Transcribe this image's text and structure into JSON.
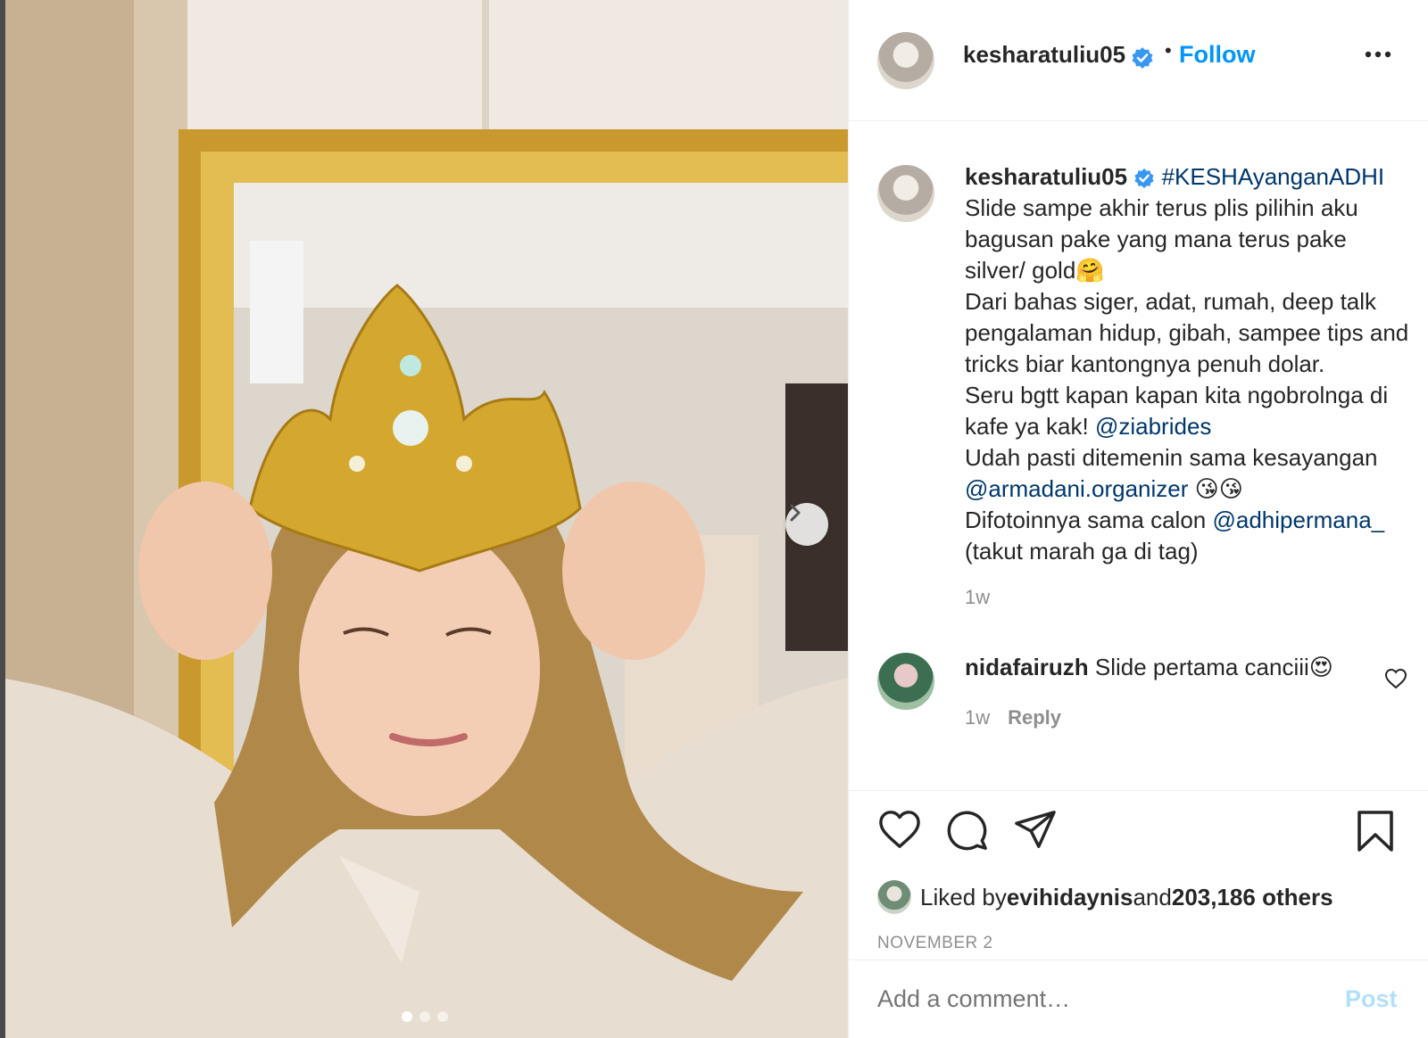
{
  "post": {
    "username": "kesharatuliu05",
    "follow_label": "Follow",
    "separator": "•",
    "caption": {
      "username": "kesharatuliu05",
      "hashtag": "#KESHAyanganADHI",
      "line1": "Slide sampe akhir terus plis pilihin aku bagusan pake yang mana terus pake silver/ gold🤗",
      "line2": "Dari bahas siger, adat, rumah, deep talk pengalaman hidup, gibah, sampee tips and tricks biar kantongnya penuh dolar.",
      "line3_pre": "Seru bgtt kapan kapan kita ngobrolnga di kafe ya kak! ",
      "mention1": "@ziabrides",
      "line4_pre": "Udah pasti ditemenin sama kesayangan ",
      "mention2": "@armadani.organizer",
      "line4_post": " 😘😘",
      "line5_pre": "Difotoinnya sama calon ",
      "mention3": "@adhipermana_",
      "line6": "(takut marah ga di tag)",
      "time": "1w"
    },
    "comment": {
      "username": "nidafairuzh",
      "text": " Slide pertama canciii😍",
      "time": "1w",
      "reply_label": "Reply"
    },
    "likes": {
      "prefix": "Liked by ",
      "user": "evihidaynis",
      "middle": " and ",
      "count": "203,186 others"
    },
    "date": "NOVEMBER 2",
    "add_comment_placeholder": "Add a comment…",
    "post_label": "Post",
    "carousel": {
      "slides": 3,
      "active": 0
    },
    "icons": {
      "verified": "verified-badge-icon",
      "more": "more-options-icon",
      "like": "heart-icon",
      "comment": "comment-icon",
      "share": "send-icon",
      "save": "bookmark-icon",
      "next": "chevron-right-icon"
    },
    "colors": {
      "link": "#00376b",
      "follow": "#0095f6",
      "post_disabled": "#b2dffc",
      "verified": "#3897f0"
    }
  }
}
